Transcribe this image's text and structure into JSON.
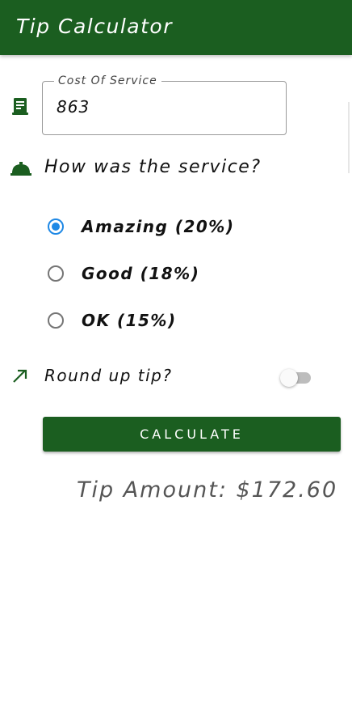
{
  "appbar": {
    "title": "Tip Calculator",
    "color": "#1b5e20"
  },
  "cost_field": {
    "label": "Cost Of Service",
    "value": "863",
    "icon": "receipt-icon"
  },
  "service_question": {
    "label": "How was the service?",
    "icon": "room-service-bell-icon"
  },
  "service_options": [
    {
      "label": "Amazing (20%)",
      "selected": true
    },
    {
      "label": "Good (18%)",
      "selected": false
    },
    {
      "label": "OK (15%)",
      "selected": false
    }
  ],
  "round_up": {
    "label": "Round up tip?",
    "enabled": false,
    "icon": "trending-up-arrow-icon"
  },
  "calculate_button": {
    "label": "CALCULATE"
  },
  "result": {
    "text": "Tip Amount: $172.60"
  },
  "colors": {
    "primary": "#1b5e20",
    "radio_accent": "#1e88e5"
  }
}
